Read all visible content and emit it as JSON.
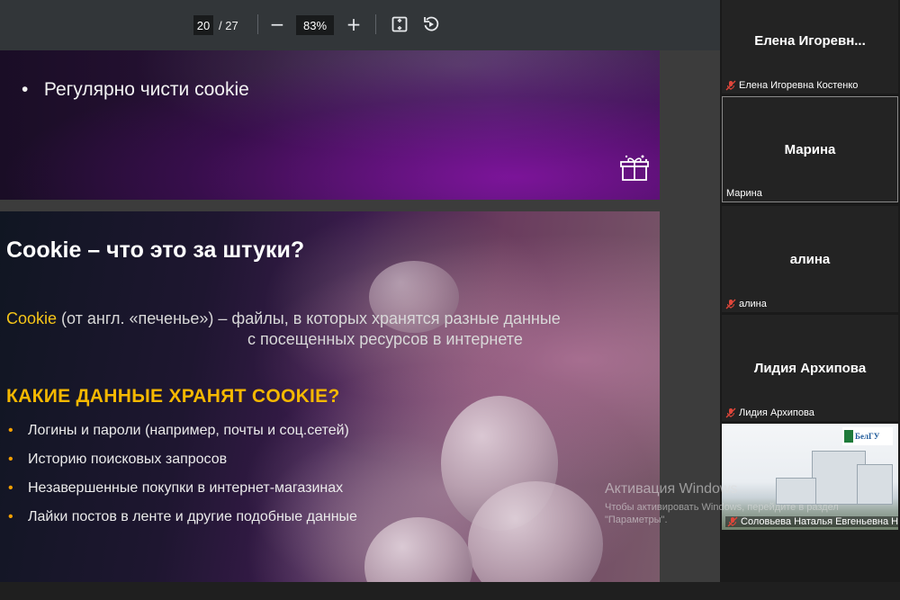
{
  "toolbar": {
    "current_page": "20",
    "page_sep_total": "/ 27",
    "zoom_out": "−",
    "zoom_level": "83%",
    "zoom_in": "+"
  },
  "slide1": {
    "bullet": "Регулярно чисти cookie"
  },
  "slide2": {
    "title": "Cookie – что это за штуки?",
    "def_highlight": "Cookie",
    "def_rest_line1": " (от англ. «печенье») – файлы, в которых хранятся разные данные",
    "def_line2": "с посещенных ресурсов в интернете",
    "heading": "КАКИЕ ДАННЫЕ ХРАНЯТ COOKIE?",
    "items": [
      "Логины и пароли (например, почты и соц.сетей)",
      "Историю поисковых запросов",
      "Незавершенные покупки в интернет-магазинах",
      "Лайки постов в ленте и другие подобные данные"
    ]
  },
  "participants": [
    {
      "big": "Елена  Игоревн...",
      "label": "Елена Игоревна Костенко",
      "muted": true
    },
    {
      "big": "Марина",
      "label": "Марина",
      "muted": false
    },
    {
      "big": "алина",
      "label": "алина",
      "muted": true
    },
    {
      "big": "Лидия Архипова",
      "label": "Лидия Архипова",
      "muted": true
    },
    {
      "big": "",
      "label": "Соловьева Наталья Евгеньевна Н...",
      "muted": true
    }
  ],
  "video_logo_text": "БелГУ",
  "watermark": {
    "line1": "Активация Windows",
    "line2": "Чтобы активировать Windows, перейдите в раздел",
    "line3": "\"Параметры\"."
  },
  "colors": {
    "highlight_yellow": "#f5c518",
    "heading_orange": "#f5b800",
    "mic_off_red": "#e0463a"
  }
}
